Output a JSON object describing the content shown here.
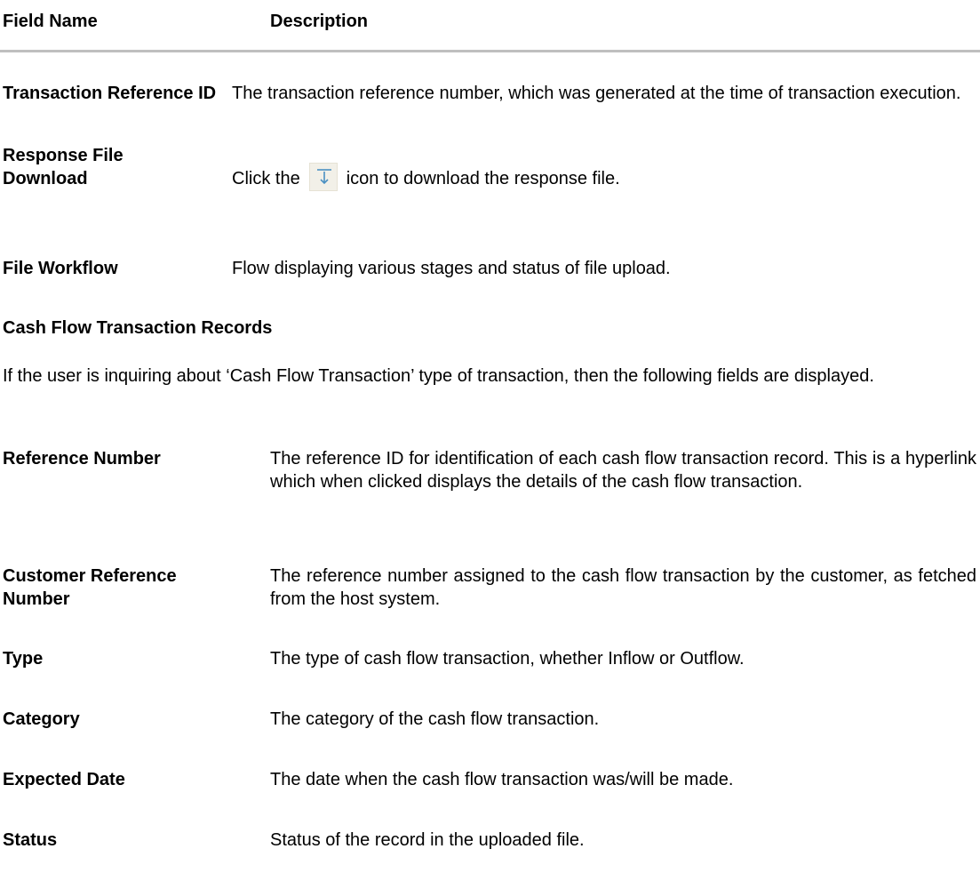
{
  "header": {
    "field_name_label": "Field Name",
    "description_label": "Description"
  },
  "top_rows": [
    {
      "field": "Transaction Reference ID",
      "description": "The transaction reference number, which was generated at the time of transaction execution."
    },
    {
      "field": "Response File Download",
      "description_before": "Click the",
      "description_after": "icon to download the response file.",
      "icon": "download-icon"
    },
    {
      "field": "File Workflow",
      "description": "Flow displaying various stages and status of file upload."
    }
  ],
  "section": {
    "title": "Cash Flow Transaction Records",
    "intro": "If the user is inquiring about ‘Cash Flow Transaction’ type of transaction, then the following fields are displayed."
  },
  "rows": [
    {
      "field": "Reference Number",
      "description": "The reference ID for identification of each cash flow transaction record. This is a hyperlink which when clicked displays the details of the cash flow transaction."
    },
    {
      "field": "Customer Reference Number",
      "description": "The reference number assigned to the cash flow transaction by the customer, as fetched from the host system."
    },
    {
      "field": "Type",
      "description": "The type of cash flow transaction, whether Inflow or Outflow."
    },
    {
      "field": "Category",
      "description": "The category of the cash flow transaction."
    },
    {
      "field": "Expected Date",
      "description": "The date when the cash flow transaction was/will be made."
    },
    {
      "field": "Status",
      "description": "Status of the record in the uploaded file."
    }
  ],
  "colors": {
    "rule": "#bfbfbf",
    "icon_bg": "#f2f0e8",
    "icon_stroke": "#4a90c2"
  }
}
